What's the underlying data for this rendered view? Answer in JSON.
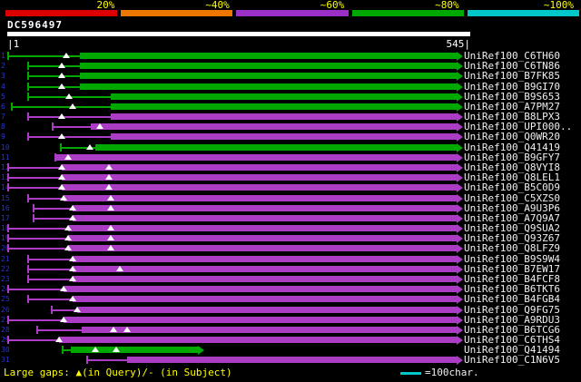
{
  "colors": {
    "background": "#000000",
    "bar_green": "#00a800",
    "bar_purple": "#ab3cc4",
    "gap_marker": "#ffffff",
    "label_text": "#f0f0f0",
    "scale_label_text": "#ffff00",
    "row_number": "#2a35c8",
    "query_bar": "#ffffff"
  },
  "query": {
    "name": "DC596497",
    "start_label": "|1",
    "end_label": "545|",
    "length": 545
  },
  "legend": {
    "large_gaps": "Large gaps: ▲(in Query)/- (in Subject)",
    "unit_label": "=100char.",
    "unit_color": "#00c8c8"
  },
  "chart_data": {
    "type": "bar",
    "orientation": "horizontal",
    "title": "DC596497",
    "x_range": [
      1,
      545
    ],
    "legend_position": "top",
    "identity_segments": [
      {
        "label": "20%",
        "color": "#dd0000"
      },
      {
        "label": "~40%",
        "color": "#ee7700"
      },
      {
        "label": "~60%",
        "color": "#9b30c8"
      },
      {
        "label": "~80%",
        "color": "#00a800"
      },
      {
        "label": "~100%",
        "color": "#00c8c8"
      }
    ],
    "hits": [
      {
        "num": "1",
        "label": "UniRef100_C6TH60",
        "color": "green",
        "identity_bucket": "~80%",
        "query_span": [
          1,
          530
        ],
        "px": {
          "s": 8,
          "t": 88,
          "e": 503,
          "gaps": [
            73
          ]
        }
      },
      {
        "num": "2",
        "label": "UniRef100_C6TN86",
        "color": "green",
        "identity_bucket": "~80%",
        "query_span": [
          25,
          530
        ],
        "px": {
          "s": 30,
          "t": 88,
          "e": 503,
          "gaps": [
            68
          ]
        }
      },
      {
        "num": "3",
        "label": "UniRef100_B7FK85",
        "color": "green",
        "identity_bucket": "~80%",
        "query_span": [
          25,
          530
        ],
        "px": {
          "s": 30,
          "t": 88,
          "e": 503,
          "gaps": [
            68
          ]
        }
      },
      {
        "num": "4",
        "label": "UniRef100_B9GI70",
        "color": "green",
        "identity_bucket": "~80%",
        "query_span": [
          25,
          530
        ],
        "px": {
          "s": 30,
          "t": 88,
          "e": 503,
          "gaps": [
            68
          ]
        }
      },
      {
        "num": "5",
        "label": "UniRef100_B9S653",
        "color": "green",
        "identity_bucket": "~80%",
        "query_span": [
          25,
          530
        ],
        "px": {
          "s": 30,
          "t": 122,
          "e": 503,
          "gaps": [
            76
          ]
        }
      },
      {
        "num": "6",
        "label": "UniRef100_A7PM27",
        "color": "green",
        "identity_bucket": "~80%",
        "query_span": [
          5,
          530
        ],
        "px": {
          "s": 12,
          "t": 122,
          "e": 503,
          "gaps": [
            80
          ]
        }
      },
      {
        "num": "7",
        "label": "UniRef100_B8LPX3",
        "color": "purple",
        "identity_bucket": "~60%",
        "query_span": [
          25,
          530
        ],
        "px": {
          "s": 30,
          "t": 122,
          "e": 503,
          "gaps": [
            68
          ]
        }
      },
      {
        "num": "8",
        "label": "UniRef100_UPI000..",
        "color": "purple",
        "identity_bucket": "~60%",
        "query_span": [
          53,
          530
        ],
        "px": {
          "s": 57,
          "t": 100,
          "e": 503,
          "gaps": [
            110
          ]
        }
      },
      {
        "num": "9",
        "label": "UniRef100_Q0WR20",
        "color": "purple",
        "identity_bucket": "~60%",
        "query_span": [
          25,
          530
        ],
        "px": {
          "s": 30,
          "t": 122,
          "e": 503,
          "gaps": [
            68
          ]
        }
      },
      {
        "num": "10",
        "label": "UniRef100_Q41419",
        "color": "green",
        "identity_bucket": "~80%",
        "query_span": [
          63,
          530
        ],
        "px": {
          "s": 66,
          "t": 105,
          "e": 503,
          "gaps": [
            99
          ]
        }
      },
      {
        "num": "11",
        "label": "UniRef100_B9GFY7",
        "color": "purple",
        "identity_bucket": "~60%",
        "query_span": [
          57,
          530
        ],
        "px": {
          "s": 60,
          "t": 62,
          "e": 503,
          "gaps": [
            75
          ]
        }
      },
      {
        "num": "12",
        "label": "UniRef100_Q8VYI8",
        "color": "purple",
        "identity_bucket": "~60%",
        "query_span": [
          1,
          530
        ],
        "px": {
          "s": 8,
          "t": 68,
          "e": 503,
          "gaps": [
            68,
            120
          ]
        }
      },
      {
        "num": "13",
        "label": "UniRef100_Q8LEL1",
        "color": "purple",
        "identity_bucket": "~60%",
        "query_span": [
          1,
          530
        ],
        "px": {
          "s": 8,
          "t": 68,
          "e": 503,
          "gaps": [
            68,
            120
          ]
        }
      },
      {
        "num": "14",
        "label": "UniRef100_B5C0D9",
        "color": "purple",
        "identity_bucket": "~60%",
        "query_span": [
          1,
          530
        ],
        "px": {
          "s": 8,
          "t": 68,
          "e": 503,
          "gaps": [
            68,
            120
          ]
        }
      },
      {
        "num": "15",
        "label": "UniRef100_C5XZS0",
        "color": "purple",
        "identity_bucket": "~60%",
        "query_span": [
          25,
          530
        ],
        "px": {
          "s": 30,
          "t": 70,
          "e": 503,
          "gaps": [
            70,
            122
          ]
        }
      },
      {
        "num": "16",
        "label": "UniRef100_A9U3P6",
        "color": "purple",
        "identity_bucket": "~60%",
        "query_span": [
          31,
          530
        ],
        "px": {
          "s": 36,
          "t": 80,
          "e": 503,
          "gaps": [
            80,
            122
          ]
        }
      },
      {
        "num": "17",
        "label": "UniRef100_A7Q9A7",
        "color": "purple",
        "identity_bucket": "~60%",
        "query_span": [
          31,
          530
        ],
        "px": {
          "s": 36,
          "t": 80,
          "e": 503,
          "gaps": [
            80
          ]
        }
      },
      {
        "num": "18",
        "label": "UniRef100_Q9SUA2",
        "color": "purple",
        "identity_bucket": "~60%",
        "query_span": [
          1,
          530
        ],
        "px": {
          "s": 8,
          "t": 75,
          "e": 503,
          "gaps": [
            75,
            122
          ]
        }
      },
      {
        "num": "19",
        "label": "UniRef100_Q93Z67",
        "color": "purple",
        "identity_bucket": "~60%",
        "query_span": [
          1,
          530
        ],
        "px": {
          "s": 8,
          "t": 75,
          "e": 503,
          "gaps": [
            75,
            122
          ]
        }
      },
      {
        "num": "20",
        "label": "UniRef100_Q8LFZ9",
        "color": "purple",
        "identity_bucket": "~60%",
        "query_span": [
          1,
          530
        ],
        "px": {
          "s": 8,
          "t": 75,
          "e": 503,
          "gaps": [
            75,
            122
          ]
        }
      },
      {
        "num": "21",
        "label": "UniRef100_B9S9W4",
        "color": "purple",
        "identity_bucket": "~60%",
        "query_span": [
          25,
          530
        ],
        "px": {
          "s": 30,
          "t": 80,
          "e": 503,
          "gaps": [
            80
          ]
        }
      },
      {
        "num": "22",
        "label": "UniRef100_B7EW17",
        "color": "purple",
        "identity_bucket": "~60%",
        "query_span": [
          25,
          530
        ],
        "px": {
          "s": 30,
          "t": 80,
          "e": 503,
          "gaps": [
            80,
            132
          ]
        }
      },
      {
        "num": "23",
        "label": "UniRef100_B4FCF8",
        "color": "purple",
        "identity_bucket": "~60%",
        "query_span": [
          25,
          530
        ],
        "px": {
          "s": 30,
          "t": 80,
          "e": 503,
          "gaps": [
            80
          ]
        }
      },
      {
        "num": "24",
        "label": "UniRef100_B6TKT6",
        "color": "purple",
        "identity_bucket": "~60%",
        "query_span": [
          1,
          530
        ],
        "px": {
          "s": 8,
          "t": 70,
          "e": 503,
          "gaps": [
            70
          ]
        }
      },
      {
        "num": "25",
        "label": "UniRef100_B4FGB4",
        "color": "purple",
        "identity_bucket": "~60%",
        "query_span": [
          25,
          530
        ],
        "px": {
          "s": 30,
          "t": 80,
          "e": 503,
          "gaps": [
            80
          ]
        }
      },
      {
        "num": "26",
        "label": "UniRef100_Q9FG75",
        "color": "purple",
        "identity_bucket": "~60%",
        "query_span": [
          52,
          530
        ],
        "px": {
          "s": 56,
          "t": 85,
          "e": 503,
          "gaps": [
            85
          ]
        }
      },
      {
        "num": "27",
        "label": "UniRef100_A9RDU3",
        "color": "purple",
        "identity_bucket": "~60%",
        "query_span": [
          1,
          530
        ],
        "px": {
          "s": 8,
          "t": 70,
          "e": 503,
          "gaps": [
            70
          ]
        }
      },
      {
        "num": "28",
        "label": "UniRef100_B6TCG6",
        "color": "purple",
        "identity_bucket": "~60%",
        "query_span": [
          35,
          530
        ],
        "px": {
          "s": 40,
          "t": 90,
          "e": 503,
          "gaps": [
            125,
            140
          ]
        }
      },
      {
        "num": "29",
        "label": "UniRef100_C6THS4",
        "color": "purple",
        "identity_bucket": "~60%",
        "query_span": [
          1,
          530
        ],
        "px": {
          "s": 8,
          "t": 65,
          "e": 503,
          "gaps": [
            65
          ]
        }
      },
      {
        "num": "30",
        "label": "UniRef100_Q41494",
        "color": "green",
        "identity_bucket": "~80%",
        "query_span": [
          65,
          225
        ],
        "px": {
          "s": 68,
          "t": 78,
          "e": 218,
          "gaps": [
            105,
            128
          ]
        }
      },
      {
        "num": "31",
        "label": "UniRef100_C1N6V5",
        "color": "purple",
        "identity_bucket": "~60%",
        "query_span": [
          94,
          530
        ],
        "px": {
          "s": 95,
          "t": 140,
          "e": 503,
          "gaps": []
        }
      }
    ]
  }
}
